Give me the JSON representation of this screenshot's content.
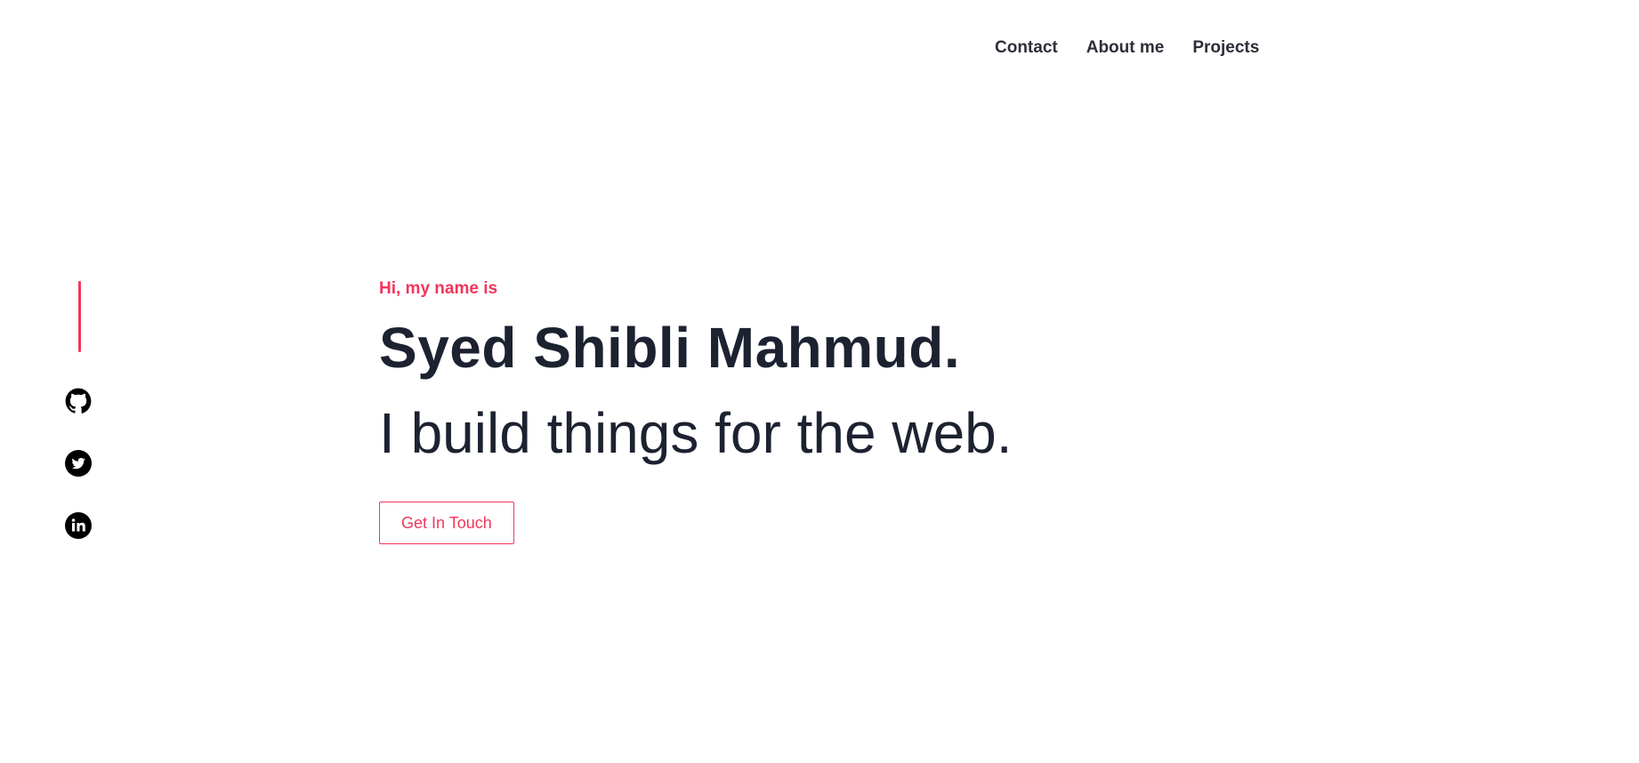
{
  "nav": {
    "items": [
      {
        "label": "Contact"
      },
      {
        "label": "About me"
      },
      {
        "label": "Projects"
      }
    ]
  },
  "social": {
    "icons": [
      "github-icon",
      "twitter-icon",
      "linkedin-icon"
    ]
  },
  "hero": {
    "eyebrow": "Hi, my name is",
    "name": "Syed Shibli Mahmud.",
    "tagline": "I build things for the web.",
    "cta_label": "Get In Touch"
  },
  "colors": {
    "accent": "#f2355c",
    "text_dark": "#1c2230",
    "nav_text": "#2d2f38",
    "background": "#ffffff"
  }
}
